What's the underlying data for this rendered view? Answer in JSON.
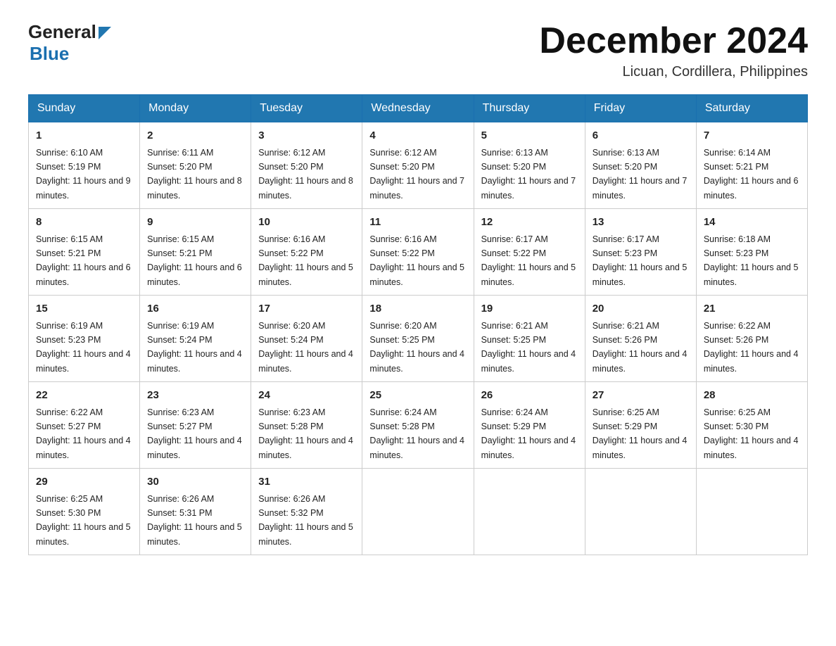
{
  "header": {
    "logo_general": "General",
    "logo_blue": "Blue",
    "month_title": "December 2024",
    "location": "Licuan, Cordillera, Philippines"
  },
  "weekdays": [
    "Sunday",
    "Monday",
    "Tuesday",
    "Wednesday",
    "Thursday",
    "Friday",
    "Saturday"
  ],
  "weeks": [
    [
      {
        "day": "1",
        "sunrise": "6:10 AM",
        "sunset": "5:19 PM",
        "daylight": "11 hours and 9 minutes."
      },
      {
        "day": "2",
        "sunrise": "6:11 AM",
        "sunset": "5:20 PM",
        "daylight": "11 hours and 8 minutes."
      },
      {
        "day": "3",
        "sunrise": "6:12 AM",
        "sunset": "5:20 PM",
        "daylight": "11 hours and 8 minutes."
      },
      {
        "day": "4",
        "sunrise": "6:12 AM",
        "sunset": "5:20 PM",
        "daylight": "11 hours and 7 minutes."
      },
      {
        "day": "5",
        "sunrise": "6:13 AM",
        "sunset": "5:20 PM",
        "daylight": "11 hours and 7 minutes."
      },
      {
        "day": "6",
        "sunrise": "6:13 AM",
        "sunset": "5:20 PM",
        "daylight": "11 hours and 7 minutes."
      },
      {
        "day": "7",
        "sunrise": "6:14 AM",
        "sunset": "5:21 PM",
        "daylight": "11 hours and 6 minutes."
      }
    ],
    [
      {
        "day": "8",
        "sunrise": "6:15 AM",
        "sunset": "5:21 PM",
        "daylight": "11 hours and 6 minutes."
      },
      {
        "day": "9",
        "sunrise": "6:15 AM",
        "sunset": "5:21 PM",
        "daylight": "11 hours and 6 minutes."
      },
      {
        "day": "10",
        "sunrise": "6:16 AM",
        "sunset": "5:22 PM",
        "daylight": "11 hours and 5 minutes."
      },
      {
        "day": "11",
        "sunrise": "6:16 AM",
        "sunset": "5:22 PM",
        "daylight": "11 hours and 5 minutes."
      },
      {
        "day": "12",
        "sunrise": "6:17 AM",
        "sunset": "5:22 PM",
        "daylight": "11 hours and 5 minutes."
      },
      {
        "day": "13",
        "sunrise": "6:17 AM",
        "sunset": "5:23 PM",
        "daylight": "11 hours and 5 minutes."
      },
      {
        "day": "14",
        "sunrise": "6:18 AM",
        "sunset": "5:23 PM",
        "daylight": "11 hours and 5 minutes."
      }
    ],
    [
      {
        "day": "15",
        "sunrise": "6:19 AM",
        "sunset": "5:23 PM",
        "daylight": "11 hours and 4 minutes."
      },
      {
        "day": "16",
        "sunrise": "6:19 AM",
        "sunset": "5:24 PM",
        "daylight": "11 hours and 4 minutes."
      },
      {
        "day": "17",
        "sunrise": "6:20 AM",
        "sunset": "5:24 PM",
        "daylight": "11 hours and 4 minutes."
      },
      {
        "day": "18",
        "sunrise": "6:20 AM",
        "sunset": "5:25 PM",
        "daylight": "11 hours and 4 minutes."
      },
      {
        "day": "19",
        "sunrise": "6:21 AM",
        "sunset": "5:25 PM",
        "daylight": "11 hours and 4 minutes."
      },
      {
        "day": "20",
        "sunrise": "6:21 AM",
        "sunset": "5:26 PM",
        "daylight": "11 hours and 4 minutes."
      },
      {
        "day": "21",
        "sunrise": "6:22 AM",
        "sunset": "5:26 PM",
        "daylight": "11 hours and 4 minutes."
      }
    ],
    [
      {
        "day": "22",
        "sunrise": "6:22 AM",
        "sunset": "5:27 PM",
        "daylight": "11 hours and 4 minutes."
      },
      {
        "day": "23",
        "sunrise": "6:23 AM",
        "sunset": "5:27 PM",
        "daylight": "11 hours and 4 minutes."
      },
      {
        "day": "24",
        "sunrise": "6:23 AM",
        "sunset": "5:28 PM",
        "daylight": "11 hours and 4 minutes."
      },
      {
        "day": "25",
        "sunrise": "6:24 AM",
        "sunset": "5:28 PM",
        "daylight": "11 hours and 4 minutes."
      },
      {
        "day": "26",
        "sunrise": "6:24 AM",
        "sunset": "5:29 PM",
        "daylight": "11 hours and 4 minutes."
      },
      {
        "day": "27",
        "sunrise": "6:25 AM",
        "sunset": "5:29 PM",
        "daylight": "11 hours and 4 minutes."
      },
      {
        "day": "28",
        "sunrise": "6:25 AM",
        "sunset": "5:30 PM",
        "daylight": "11 hours and 4 minutes."
      }
    ],
    [
      {
        "day": "29",
        "sunrise": "6:25 AM",
        "sunset": "5:30 PM",
        "daylight": "11 hours and 5 minutes."
      },
      {
        "day": "30",
        "sunrise": "6:26 AM",
        "sunset": "5:31 PM",
        "daylight": "11 hours and 5 minutes."
      },
      {
        "day": "31",
        "sunrise": "6:26 AM",
        "sunset": "5:32 PM",
        "daylight": "11 hours and 5 minutes."
      },
      null,
      null,
      null,
      null
    ]
  ]
}
